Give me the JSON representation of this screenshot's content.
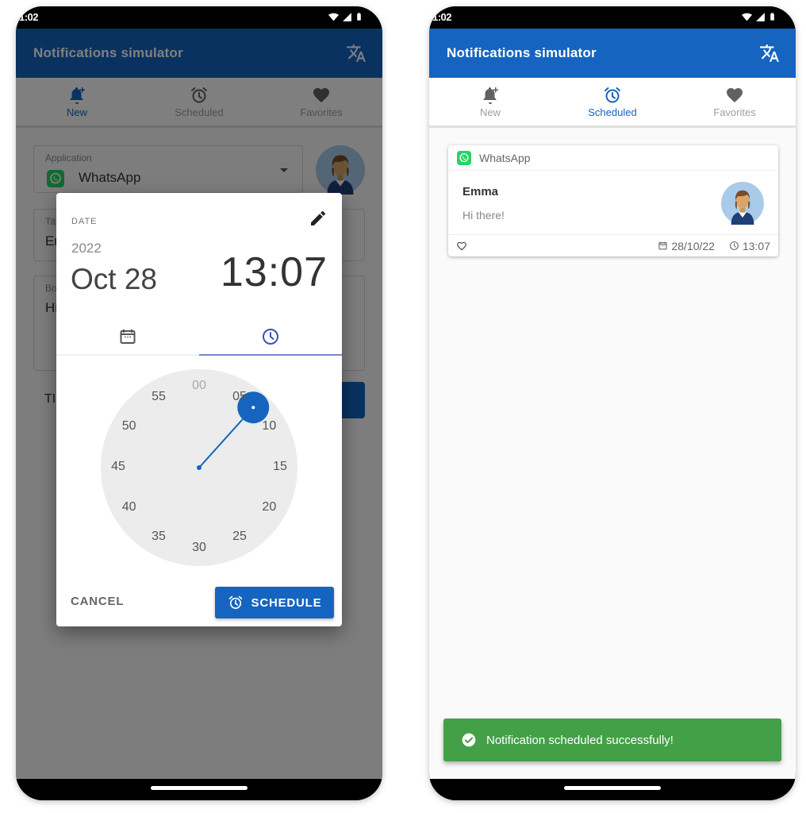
{
  "left_phone": {
    "status_time": "1:02",
    "app_title": "Notifications simulator",
    "tabs": [
      {
        "label": "New",
        "icon": "bell-plus-icon",
        "active": true
      },
      {
        "label": "Scheduled",
        "icon": "alarm-clock-icon",
        "active": false
      },
      {
        "label": "Favorites",
        "icon": "heart-icon",
        "active": false
      }
    ],
    "form": {
      "application_label": "Application",
      "application_value": "WhatsApp",
      "title_label": "Title",
      "title_value": "Emma",
      "body_label": "Body",
      "body_value": "Hi there!",
      "time_label": "TI"
    },
    "dialog": {
      "date_label": "DATE",
      "year": "2022",
      "date": "Oct 28",
      "time": "13:07",
      "tabs": [
        {
          "icon": "calendar-icon",
          "active": false
        },
        {
          "icon": "clock-icon",
          "active": true
        }
      ],
      "clock": {
        "mode": "minutes",
        "selected_minute": 7,
        "numbers": [
          "00",
          "05",
          "10",
          "15",
          "20",
          "25",
          "30",
          "35",
          "40",
          "45",
          "50",
          "55"
        ]
      },
      "cancel_label": "CANCEL",
      "schedule_label": "SCHEDULE"
    }
  },
  "right_phone": {
    "status_time": "1:02",
    "app_title": "Notifications simulator",
    "tabs": [
      {
        "label": "New",
        "icon": "bell-plus-icon",
        "active": false
      },
      {
        "label": "Scheduled",
        "icon": "alarm-clock-icon",
        "active": true
      },
      {
        "label": "Favorites",
        "icon": "heart-icon",
        "active": false
      }
    ],
    "card": {
      "app_name": "WhatsApp",
      "sender": "Emma",
      "message": "Hi there!",
      "date": "28/10/22",
      "time": "13:07"
    },
    "snackbar": {
      "message": "Notification scheduled successfully!"
    }
  },
  "colors": {
    "primary": "#1565c0",
    "success": "#43a047",
    "whatsapp": "#25d366"
  }
}
